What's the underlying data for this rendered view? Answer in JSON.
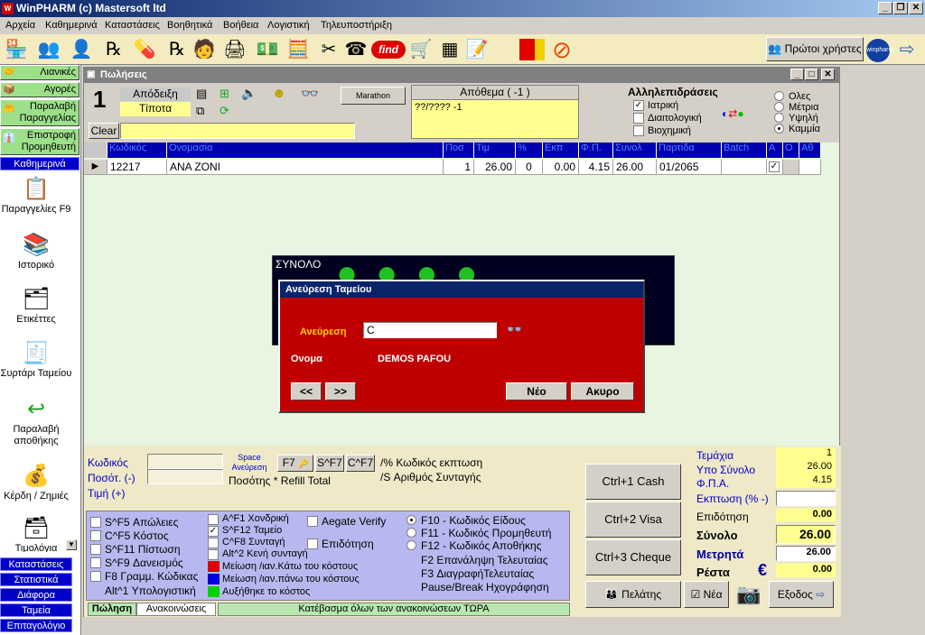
{
  "app": {
    "title": "WinPHARM (c) Mastersoft ltd"
  },
  "menu": [
    "Αρχεία",
    "Καθημερινά",
    "Καταστάσεις",
    "Βοηθητικά",
    "Βοήθεια",
    "Λογιστική",
    "Τηλευποστήριξη"
  ],
  "toolbar": {
    "first_users": "Πρώτοι χρήστες",
    "find": "find",
    "winpharm": "winpharm"
  },
  "sidebar": {
    "top_items": [
      "Λιανικές",
      "Αγορές",
      "Παραλαβή Παραγγελίας",
      "Επιστροφή Προμηθευτή"
    ],
    "section_daily": "Καθημερινά",
    "icons": [
      "Παραγγελίες F9",
      "Ιστορικό",
      "Ετικέττες",
      "Συρτάρι Ταμείου",
      "Παραλαβή αποθήκης",
      "Κέρδη / Ζημιές",
      "Τιμολόγια"
    ],
    "bottom_items": [
      "Καταστάσεις",
      "Στατιστικά",
      "Διάφορα",
      "Ταμεία",
      "Επιταγολόγιο"
    ]
  },
  "sales": {
    "title": "Πωλήσεις",
    "number": "1",
    "receipt_label": "Απόδειξη",
    "receipt_value": "Τίποτα",
    "marathon": "Marathon",
    "clear": "Clear",
    "stock_title": "Απόθεμα ( -1 )",
    "stock_value": "??/????  -1",
    "interactions_title": "Αλληλεπιδράσεις",
    "interactions": [
      {
        "label": "Ιατρική",
        "checked": true
      },
      {
        "label": "Διαιτολογική",
        "checked": false
      },
      {
        "label": "Βιοχημική",
        "checked": false
      }
    ],
    "levels": [
      {
        "label": "Ολες",
        "on": false
      },
      {
        "label": "Μέτρια",
        "on": false
      },
      {
        "label": "Υψηλή",
        "on": false
      },
      {
        "label": "Καμμία",
        "on": true
      }
    ],
    "grid_headers": [
      "Κωδικός",
      "Ονομασία",
      "Ποσ",
      "Τιμ",
      "%",
      "Εκπ",
      "Φ.Π.",
      "Συνολ",
      "Παρτίδα",
      "Batch",
      "Α",
      "Ο",
      "Αθ"
    ],
    "row": {
      "code": "12217",
      "name": "ANA ZONI",
      "qty": "1",
      "price": "26.00",
      "pct": "0",
      "disc": "0.00",
      "fp": "4.15",
      "total": "26.00",
      "lot": "01/2065"
    }
  },
  "total_panel": {
    "label": "ΣΥΝΟΛΟ"
  },
  "dialog": {
    "title": "Ανεύρεση Ταμείου",
    "search_label": "Ανεύρεση",
    "search_value": "C",
    "name_label": "Ονομα",
    "name_value": "DEMOS PAFOU",
    "prev": "<<",
    "next": ">>",
    "new": "Νέο",
    "cancel": "Ακυρο"
  },
  "entry": {
    "code_label": "Κωδικός",
    "qty_label": "Ποσότ. (-)",
    "price_label": "Τιμή (+)",
    "space_label": "Space Ανεύρεση",
    "f7": "F7",
    "sf7": "S^F7",
    "cf7": "C^F7",
    "pct_hint": "/% Κωδικός εκπτωση",
    "s_hint": "/S Αριθμός Συνταγής",
    "qty_hint": "Ποσότης * Refill Total"
  },
  "options_col1": [
    {
      "label": "S^F5 Απώλειες",
      "checked": false
    },
    {
      "label": "C^F5 Κόστος",
      "checked": false
    },
    {
      "label": "S^F11 Πίστωση",
      "checked": false
    },
    {
      "label": "S^F9 Δανεισμός",
      "checked": false
    },
    {
      "label": "F8 Γραμμ. Κώδικας",
      "checked": false
    }
  ],
  "alt1": "Alt^1 Υπολογιστική",
  "options_col2": [
    {
      "label": "A^F1 Χονδρική",
      "checked": false
    },
    {
      "label": "S^F12 Ταμείο",
      "checked": true
    },
    {
      "label": "C^F8 Συνταγή",
      "checked": false
    },
    {
      "label": "Alt^2 Κενή συνταγή",
      "checked": false
    }
  ],
  "legend": [
    {
      "label": "Μείωση /ιαν.Κάτω του κόστους",
      "color": "#e00000"
    },
    {
      "label": "Μείωση /ιαν.πάνω του κόστους",
      "color": "#0000e0"
    },
    {
      "label": "Αυξήθηκε το κόστος",
      "color": "#00d000"
    }
  ],
  "options_col3": [
    {
      "label": "Aegate Verify",
      "checked": false
    },
    {
      "label": "Επιδότηση",
      "checked": false
    }
  ],
  "options_radio": [
    {
      "label": "F10 - Κωδικός Είδους",
      "on": true
    },
    {
      "label": "F11 - Κωδικός Προμηθευτή",
      "on": false
    },
    {
      "label": "F12 - Κωδικός Αποθήκης",
      "on": false
    }
  ],
  "hints": [
    "F2 Επανάληψη Τελευταίας",
    "F3 ΔιαγραφήΤελευταίας",
    "Pause/Break Ηχογράφηση"
  ],
  "payments": [
    "Ctrl+1 Cash",
    "Ctrl+2 Visa",
    "Ctrl+3 Cheque"
  ],
  "totals": {
    "items_label": "Τεμάχια",
    "items_value": "1",
    "subtotal_label": "Υπο Σύνολο",
    "subtotal_value": "26.00",
    "vat_label": "Φ.Π.Α.",
    "vat_value": "4.15",
    "discount_label": "Εκπτωση (% -)",
    "discount_value": "",
    "subsidy_label": "Επιδότηση",
    "subsidy_value": "0.00",
    "total_label": "Σύνολο",
    "total_value": "26.00",
    "cash_label": "Μετρητά",
    "cash_value": "26.00",
    "change_label": "Ρέστα",
    "change_value": "0.00"
  },
  "bottom": {
    "customer": "Πελάτης",
    "new": "Νέα",
    "exit": "Εξοδος",
    "tab_sale": "Πώληση",
    "tab_announce": "Ανακοινώσεις",
    "status": "Κατέβασμα όλων των ανακοινώσεων ΤΩΡΑ"
  }
}
